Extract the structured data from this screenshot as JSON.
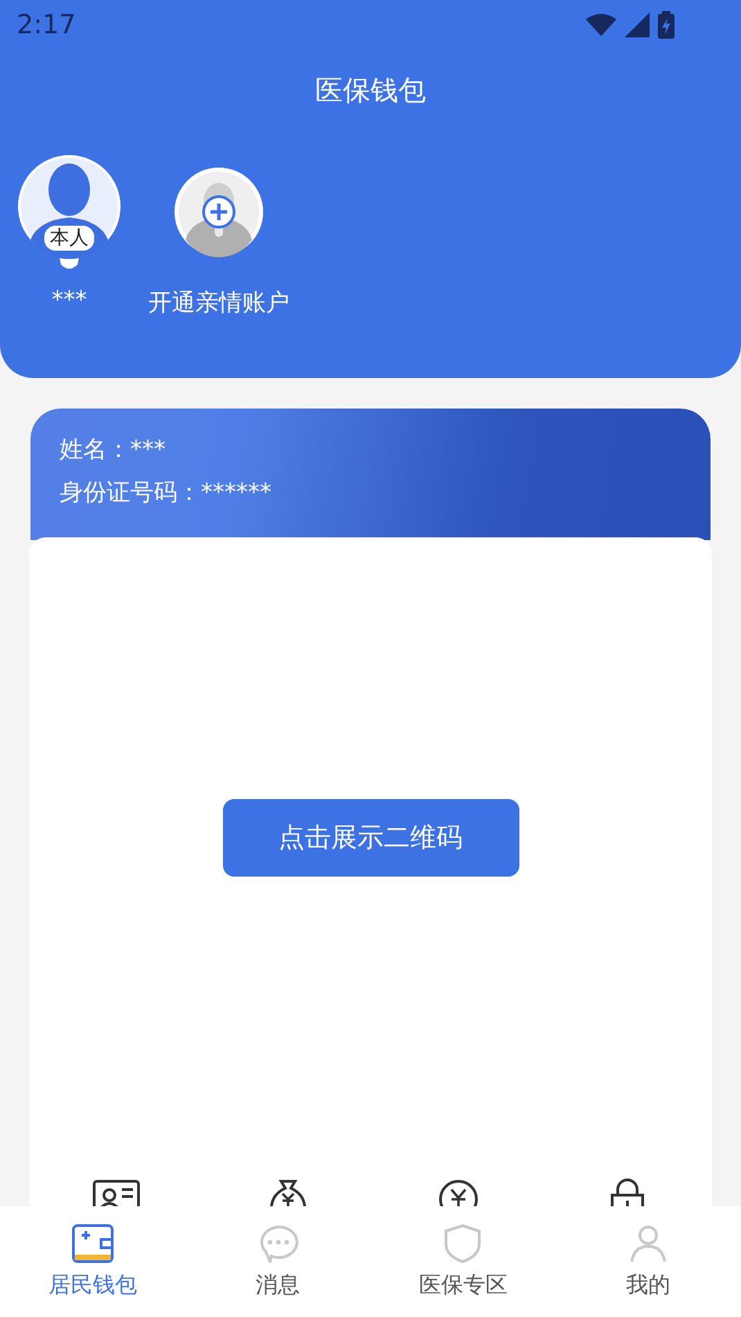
{
  "status_bar": {
    "time": "2:17"
  },
  "header": {
    "title": "医保钱包"
  },
  "accounts": [
    {
      "kind": "self",
      "badge": "本人",
      "name": "***",
      "selected": true
    },
    {
      "kind": "add",
      "name": "开通亲情账户",
      "selected": false
    }
  ],
  "card": {
    "name_line": "姓名：***",
    "id_line": "身份证号码：******",
    "button": "点击展示二维码"
  },
  "tab_bar": [
    {
      "label": "居民钱包",
      "selected": true
    },
    {
      "label": "消息",
      "selected": false
    },
    {
      "label": "医保专区",
      "selected": false
    },
    {
      "label": "我的",
      "selected": false
    }
  ]
}
